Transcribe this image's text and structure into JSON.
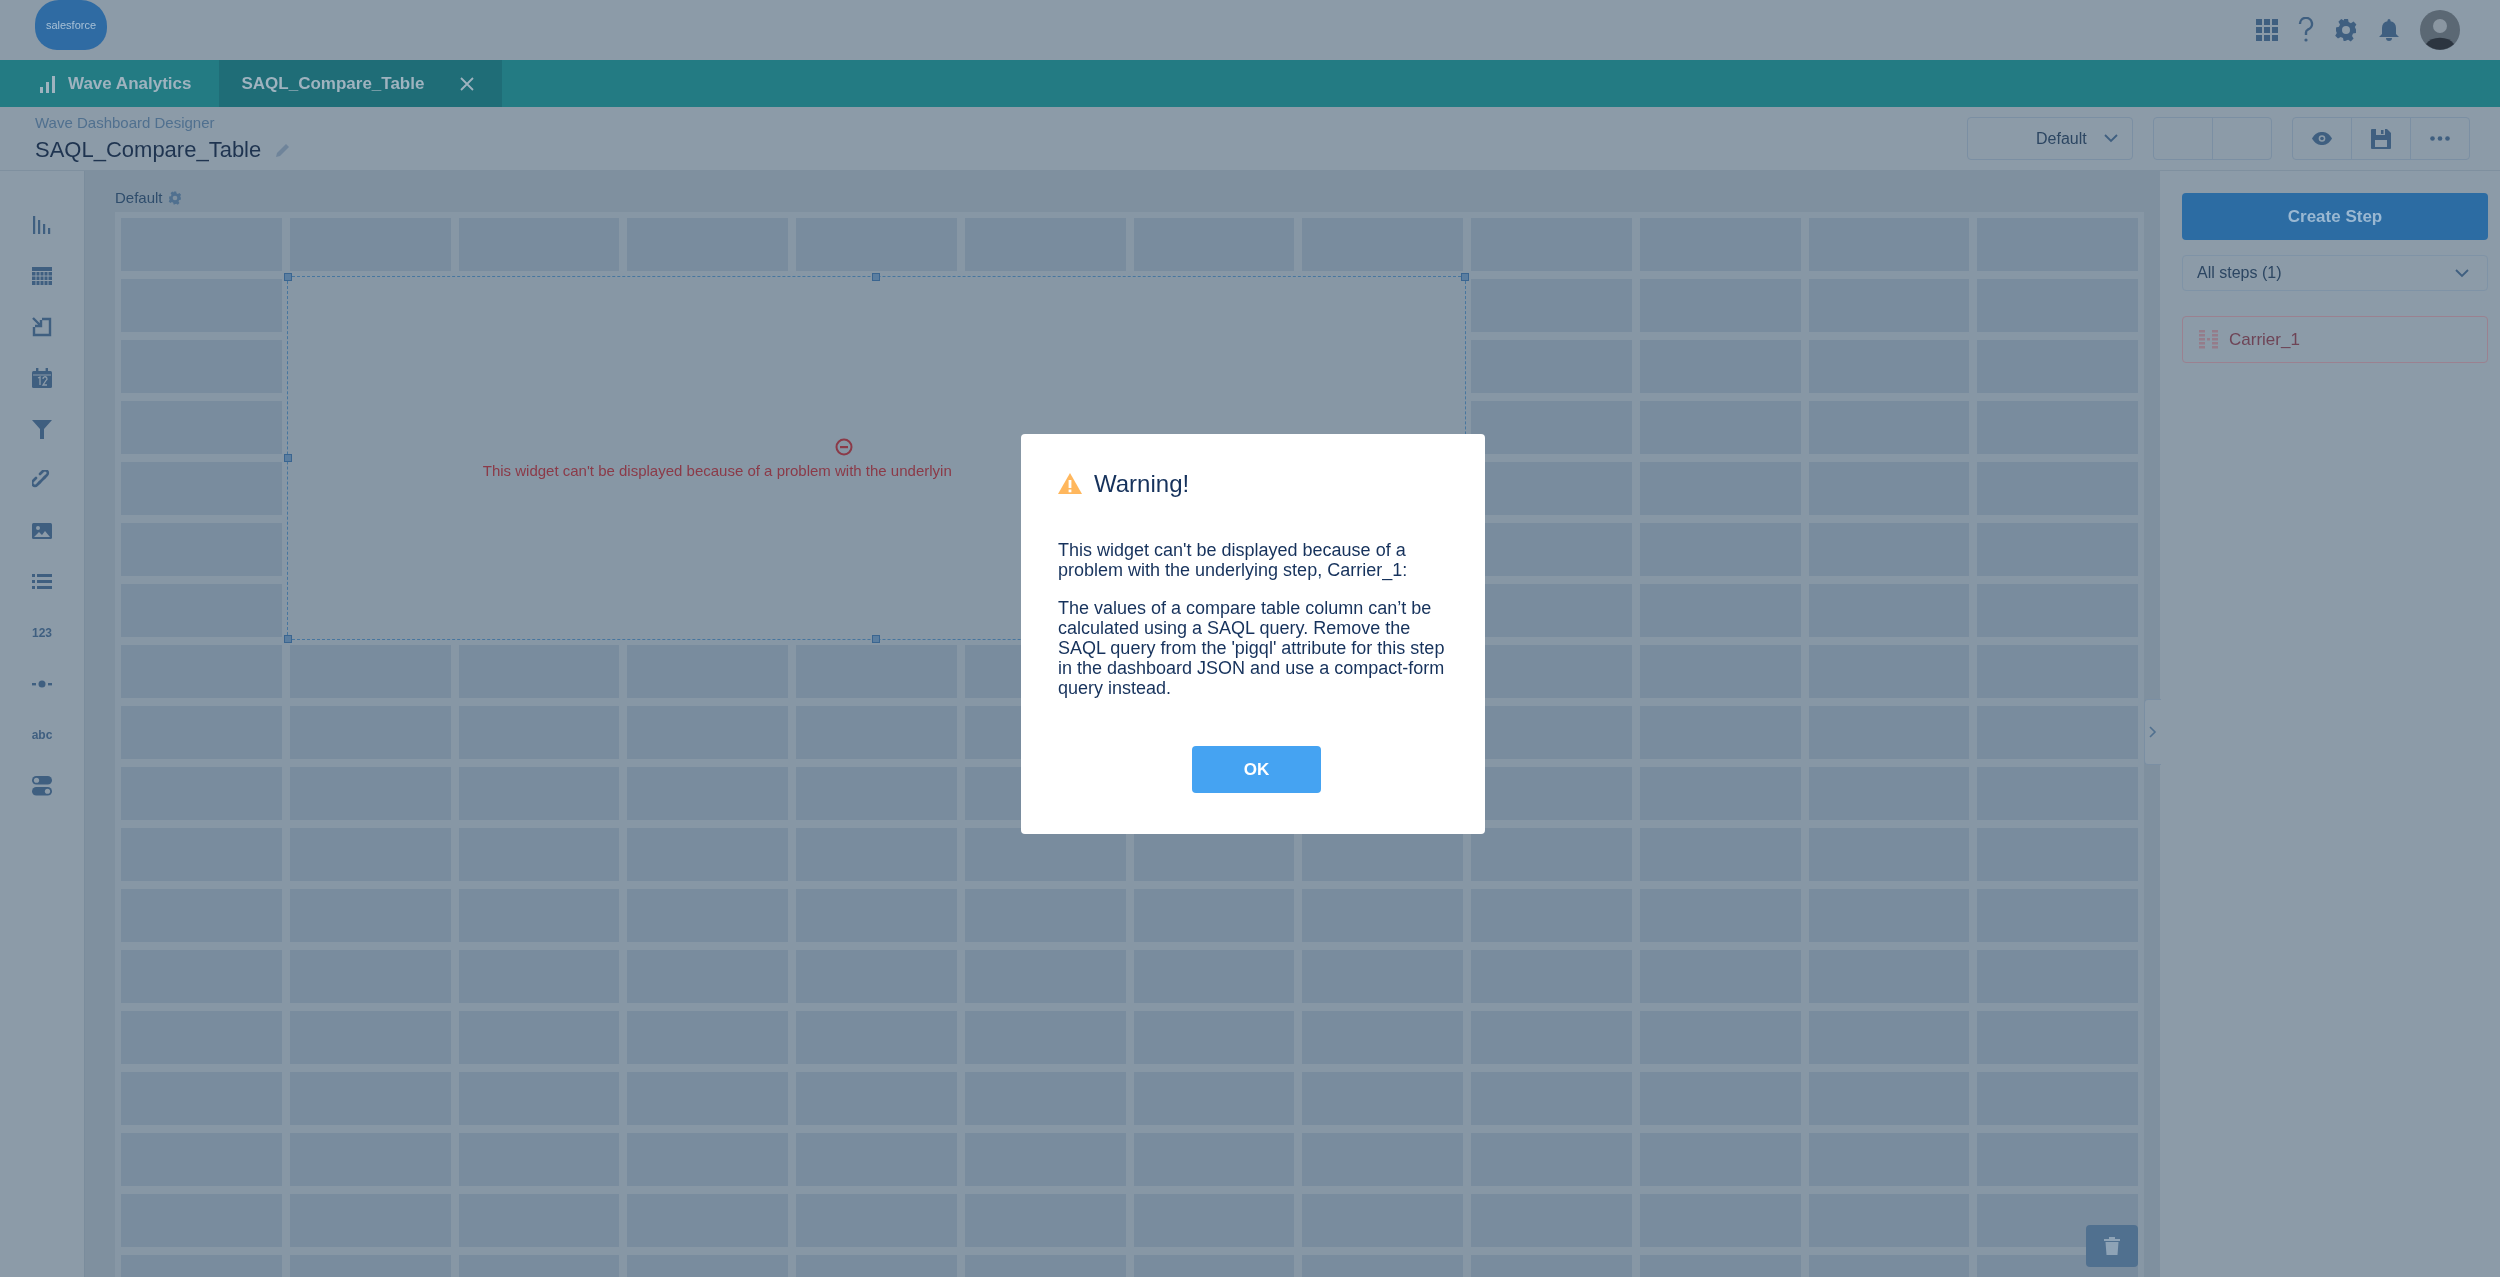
{
  "logo": {
    "text": "salesforce"
  },
  "tabs": [
    {
      "label": "Wave Analytics",
      "selected": false,
      "closable": false
    },
    {
      "label": "SAQL_Compare_Table",
      "selected": true,
      "closable": true
    }
  ],
  "designer": {
    "subtitle": "Wave Dashboard Designer",
    "title": "SAQL_Compare_Table"
  },
  "layout_select": {
    "value": "Default"
  },
  "canvas": {
    "layout_label": "Default",
    "widget_error": "This widget can't be displayed because of a problem with the underlyin"
  },
  "widget_palette": [
    {
      "kind": "chart"
    },
    {
      "kind": "table"
    },
    {
      "kind": "pillbox"
    },
    {
      "kind": "date"
    },
    {
      "kind": "filter"
    },
    {
      "kind": "link"
    },
    {
      "kind": "image"
    },
    {
      "kind": "list"
    },
    {
      "kind": "number",
      "label": "123"
    },
    {
      "kind": "range"
    },
    {
      "kind": "text",
      "label": "abc"
    },
    {
      "kind": "toggle"
    }
  ],
  "steps_panel": {
    "create_button": "Create Step",
    "filter": "All steps (1)",
    "steps": [
      {
        "name": "Carrier_1",
        "error": true
      }
    ]
  },
  "dialog": {
    "title": "Warning!",
    "paragraphs": [
      "This widget can't be displayed because of a problem with the underlying step, Carrier_1:",
      "The values of a compare table column can’t be calculated using a SAQL query. Remove the SAQL query from the 'pigql' attribute for this step in the dashboard JSON and use a compact-form query instead."
    ],
    "button": "OK"
  }
}
